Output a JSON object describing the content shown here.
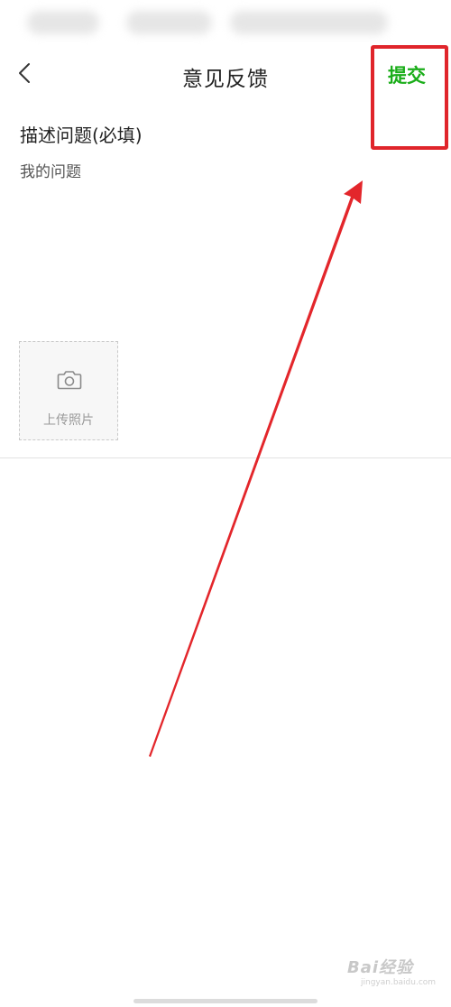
{
  "nav": {
    "back_icon": "chevron-left-icon",
    "title": "意见反馈",
    "submit_label": "提交"
  },
  "form": {
    "section_title": "描述问题(必填)",
    "problem_text": "我的问题",
    "upload": {
      "icon": "camera-icon",
      "label": "上传照片"
    }
  },
  "watermark": {
    "text": "Bai经验",
    "url": "jingyan.baidu.com"
  },
  "colors": {
    "accent": "#1aad19",
    "annotation": "#e0252b"
  }
}
